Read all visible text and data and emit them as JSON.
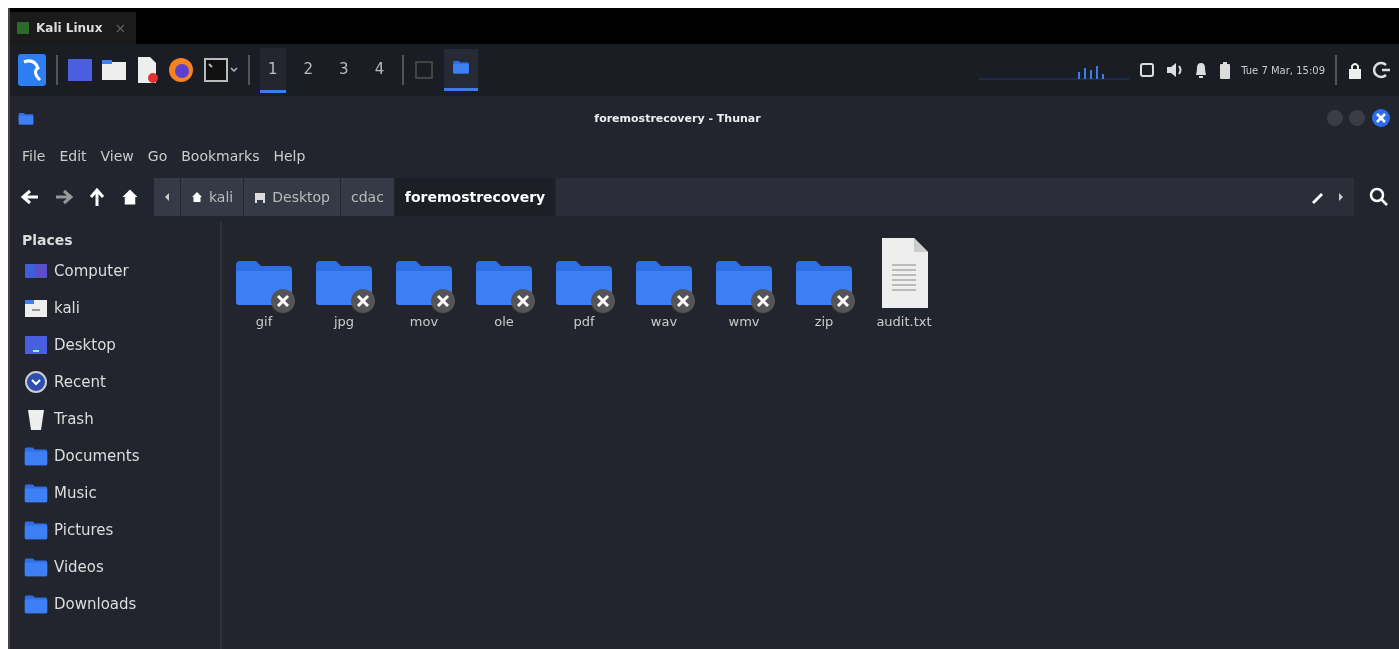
{
  "browser_tab": {
    "title": "Kali Linux",
    "close": "×"
  },
  "panel": {
    "workspaces": [
      {
        "label": "1",
        "selected": true
      },
      {
        "label": "2",
        "selected": false
      },
      {
        "label": "3",
        "selected": false
      },
      {
        "label": "4",
        "selected": false
      }
    ],
    "clock": "Tue 7 Mar, 15:09"
  },
  "window": {
    "title": "foremostrecovery - Thunar"
  },
  "menu": [
    "File",
    "Edit",
    "View",
    "Go",
    "Bookmarks",
    "Help"
  ],
  "path": [
    {
      "label": "kali",
      "kind": "home",
      "selected": false
    },
    {
      "label": "Desktop",
      "kind": "desktop",
      "selected": false
    },
    {
      "label": "cdac",
      "kind": "plain",
      "selected": false
    },
    {
      "label": "foremostrecovery",
      "kind": "plain",
      "selected": true
    }
  ],
  "sidebar": {
    "heading": "Places",
    "items": [
      {
        "label": "Computer",
        "kind": "computer"
      },
      {
        "label": "kali",
        "kind": "home"
      },
      {
        "label": "Desktop",
        "kind": "desktop"
      },
      {
        "label": "Recent",
        "kind": "recent"
      },
      {
        "label": "Trash",
        "kind": "trash"
      },
      {
        "label": "Documents",
        "kind": "folder"
      },
      {
        "label": "Music",
        "kind": "folder"
      },
      {
        "label": "Pictures",
        "kind": "folder"
      },
      {
        "label": "Videos",
        "kind": "folder"
      },
      {
        "label": "Downloads",
        "kind": "folder"
      }
    ]
  },
  "files": [
    {
      "name": "gif",
      "kind": "folder",
      "unreadable": true
    },
    {
      "name": "jpg",
      "kind": "folder",
      "unreadable": true
    },
    {
      "name": "mov",
      "kind": "folder",
      "unreadable": true
    },
    {
      "name": "ole",
      "kind": "folder",
      "unreadable": true
    },
    {
      "name": "pdf",
      "kind": "folder",
      "unreadable": true
    },
    {
      "name": "wav",
      "kind": "folder",
      "unreadable": true
    },
    {
      "name": "wmv",
      "kind": "folder",
      "unreadable": true
    },
    {
      "name": "zip",
      "kind": "folder",
      "unreadable": true
    },
    {
      "name": "audit.txt",
      "kind": "text",
      "unreadable": false
    }
  ]
}
